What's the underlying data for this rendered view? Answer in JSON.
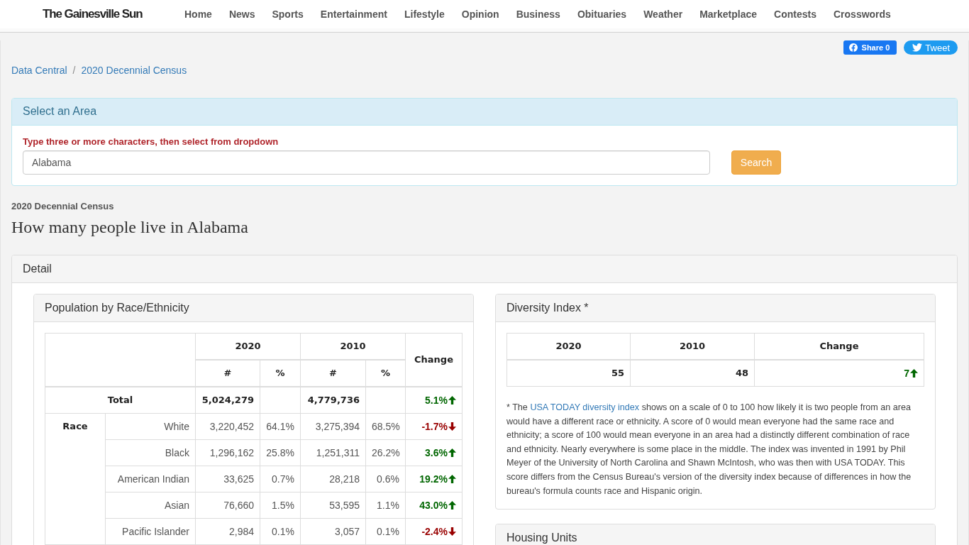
{
  "site": {
    "logo": "The Gainesville Sun",
    "nav": [
      "Home",
      "News",
      "Sports",
      "Entertainment",
      "Lifestyle",
      "Opinion",
      "Business",
      "Obituaries",
      "Weather",
      "Marketplace",
      "Contests",
      "Crosswords"
    ]
  },
  "share": [
    {
      "kind": "facebook",
      "label": "Share 0"
    },
    {
      "kind": "twitter",
      "label": "Tweet"
    }
  ],
  "breadcrumb": {
    "items": [
      "Data Central",
      "2020 Decennial Census"
    ],
    "separator": "/"
  },
  "select_area": {
    "title": "Select an Area",
    "hint": "Type three or more characters, then select from dropdown",
    "value": "Alabama",
    "button": "Search"
  },
  "kicker": "2020 Decennial Census",
  "title": "How many people live in Alabama",
  "detail": {
    "title": "Detail",
    "population": {
      "title": "Population by Race/Ethnicity",
      "years": [
        "2020",
        "2010"
      ],
      "subheads": [
        "#",
        "%",
        "#",
        "%"
      ],
      "change_label": "Change",
      "total": {
        "label": "Total",
        "pop_2020": "5,024,279",
        "pop_2010": "4,779,736",
        "change": "5.1%",
        "increase": true
      },
      "group": "Race",
      "rows": [
        {
          "label": "White",
          "pop_2020": "3,220,452",
          "pct_2020": "64.1%",
          "pop_2010": "3,275,394",
          "pct_2010": "68.5%",
          "change": "-1.7%",
          "increase": false
        },
        {
          "label": "Black",
          "pop_2020": "1,296,162",
          "pct_2020": "25.8%",
          "pop_2010": "1,251,311",
          "pct_2010": "26.2%",
          "change": "3.6%",
          "increase": true
        },
        {
          "label": "American Indian",
          "pop_2020": "33,625",
          "pct_2020": "0.7%",
          "pop_2010": "28,218",
          "pct_2010": "0.6%",
          "change": "19.2%",
          "increase": true
        },
        {
          "label": "Asian",
          "pop_2020": "76,660",
          "pct_2020": "1.5%",
          "pop_2010": "53,595",
          "pct_2010": "1.1%",
          "change": "43.0%",
          "increase": true
        },
        {
          "label": "Pacific Islander",
          "pop_2020": "2,984",
          "pct_2020": "0.1%",
          "pop_2010": "3,057",
          "pct_2010": "0.1%",
          "change": "-2.4%",
          "increase": false
        }
      ]
    },
    "diversity": {
      "title": "Diversity Index *",
      "columns": [
        "2020",
        "2010",
        "Change"
      ],
      "values": [
        "55",
        "48"
      ],
      "change": {
        "value": "7",
        "increase": true
      },
      "note": {
        "lead": "* The",
        "link": "USA TODAY diversity index",
        "rest": "shows on a scale of 0 to 100 how likely it is two people from an area would have a different race or ethnicity. A score of 0 would mean everyone had the same race and ethnicity; a score of 100 would mean everyone in an area had a distinctly different combination of race and ethnicity. Nearly everywhere is some place in the middle. The index was invented in 1991 by Phil Meyer of the University of North Carolina and Shawn McIntosh, who was then with USA TODAY. This score differs from the Census Bureau's version of the diversity index because of differences in how the bureau's formula counts race and Hispanic origin."
      }
    },
    "housing": {
      "title": "Housing Units"
    }
  }
}
